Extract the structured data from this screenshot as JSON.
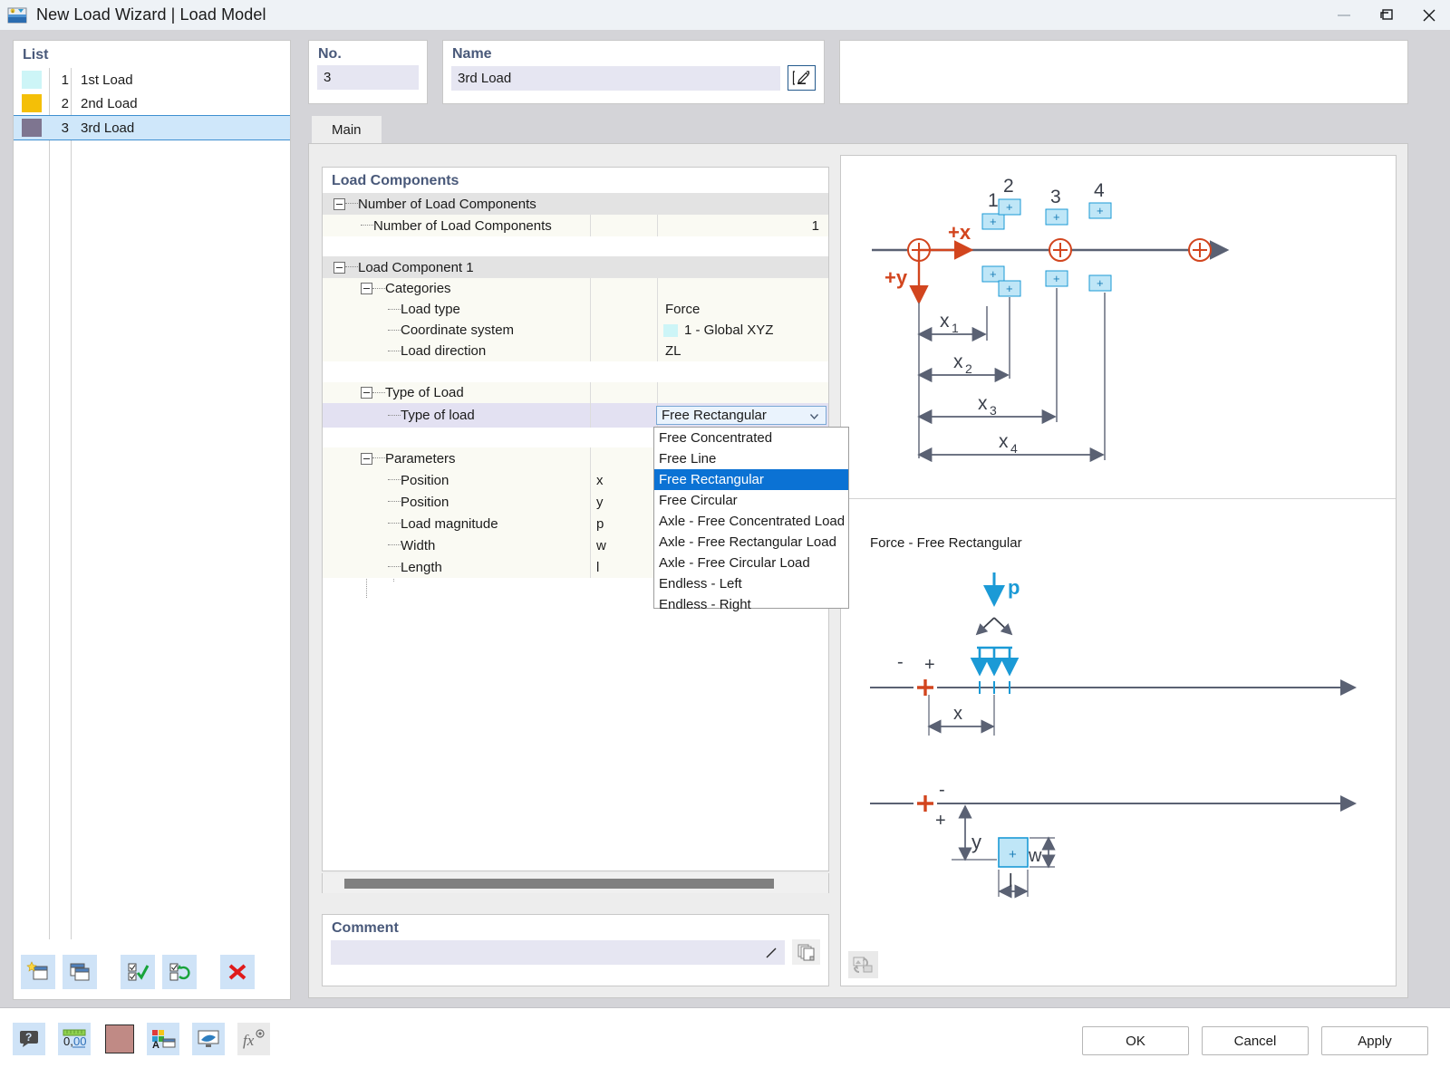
{
  "window": {
    "title": "New Load Wizard | Load Model",
    "app_icon": "load-model-icon",
    "minimize_label": "Minimize",
    "restore_label": "Restore",
    "close_label": "Close"
  },
  "list_panel": {
    "header": "List",
    "items": [
      {
        "num": "1",
        "name": "1st Load",
        "color": "#cdf5f7",
        "selected": false
      },
      {
        "num": "2",
        "name": "2nd Load",
        "color": "#f4bf07",
        "selected": false
      },
      {
        "num": "3",
        "name": "3rd Load",
        "color": "#7e7590",
        "selected": true
      }
    ],
    "tools": [
      {
        "name": "new-load-button",
        "icon": "new-window-icon"
      },
      {
        "name": "copy-load-button",
        "icon": "copy-window-icon"
      },
      {
        "name": "select-all-button",
        "icon": "check-all-icon"
      },
      {
        "name": "invert-selection-button",
        "icon": "invert-selection-icon"
      },
      {
        "name": "delete-load-button",
        "icon": "red-x-icon"
      }
    ]
  },
  "no_box": {
    "label": "No.",
    "value": "3"
  },
  "name_box": {
    "label": "Name",
    "value": "3rd Load",
    "placeholder": "",
    "edit_button": "edit-name-icon"
  },
  "tabs": [
    {
      "label": "Main",
      "active": true
    }
  ],
  "load_components": {
    "header": "Load Components",
    "rows": [
      {
        "kind": "group",
        "indent": 0,
        "label": "Number of Load Components",
        "expander": true
      },
      {
        "kind": "leaf",
        "indent": 1,
        "label": "Number of Load Components",
        "symbol": "",
        "value": "1"
      },
      {
        "kind": "blank",
        "indent": 1,
        "label": "",
        "symbol": "",
        "value": ""
      },
      {
        "kind": "group",
        "indent": 0,
        "label": "Load Component 1",
        "expander": true
      },
      {
        "kind": "group2",
        "indent": 1,
        "label": "Categories",
        "expander": true
      },
      {
        "kind": "leaf",
        "indent": 2,
        "label": "Load type",
        "symbol": "",
        "value": "Force"
      },
      {
        "kind": "leaf",
        "indent": 2,
        "label": "Coordinate system",
        "symbol": "",
        "value": "1 - Global XYZ",
        "swatch": "#cdf5f7"
      },
      {
        "kind": "leaf",
        "indent": 2,
        "label": "Load direction",
        "symbol": "",
        "value": "ZL"
      },
      {
        "kind": "blank",
        "indent": 2,
        "label": "",
        "symbol": "",
        "value": ""
      },
      {
        "kind": "group2",
        "indent": 1,
        "label": "Type of Load",
        "expander": true
      },
      {
        "kind": "selrow",
        "indent": 2,
        "label": "Type of load",
        "symbol": "",
        "value": "Free Rectangular"
      },
      {
        "kind": "blank",
        "indent": 2,
        "label": "",
        "symbol": "",
        "value": ""
      },
      {
        "kind": "group2",
        "indent": 1,
        "label": "Parameters",
        "expander": true
      },
      {
        "kind": "leaf",
        "indent": 2,
        "label": "Position",
        "symbol": "x",
        "value": ""
      },
      {
        "kind": "leaf",
        "indent": 2,
        "label": "Position",
        "symbol": "y",
        "value": ""
      },
      {
        "kind": "leaf",
        "indent": 2,
        "label": "Load magnitude",
        "symbol": "p",
        "value": ""
      },
      {
        "kind": "leaf",
        "indent": 2,
        "label": "Width",
        "symbol": "w",
        "value": ""
      },
      {
        "kind": "leaf",
        "indent": 2,
        "label": "Length",
        "symbol": "l",
        "value": ""
      }
    ]
  },
  "type_of_load_dropdown": {
    "selected": "Free Rectangular",
    "open": true,
    "options": [
      "Free Concentrated",
      "Free Line",
      "Free Rectangular",
      "Free Circular",
      "Axle - Free Concentrated Load",
      "Axle - Free Rectangular Load",
      "Axle - Free Circular Load",
      "Endless - Left",
      "Endless - Right"
    ]
  },
  "comment": {
    "label": "Comment",
    "value": "",
    "placeholder": "",
    "button_icon": "copy-comment-icon"
  },
  "illustration": {
    "caption": "Force - Free Rectangular",
    "refresh_icon": "refresh-image-icon",
    "axle_labels": [
      "1",
      "2",
      "3",
      "4"
    ],
    "axis_labels": [
      "+x",
      "+y"
    ],
    "dimension_labels": [
      "x",
      "x",
      "x",
      "x"
    ],
    "dimension_subs": [
      "1",
      "2",
      "3",
      "4"
    ],
    "detail_labels": [
      "p",
      "x",
      "y",
      "w",
      "l"
    ],
    "sign_labels": [
      "-",
      "+",
      "-",
      "+"
    ],
    "accent_red": "#d2451e",
    "accent_blue": "#1b9ad6",
    "line_gray": "#5a6173"
  },
  "bottom_bar": {
    "tools": [
      {
        "name": "help-button",
        "icon": "help-balloon-icon"
      },
      {
        "name": "decimal-places-button",
        "icon": "decimals-icon"
      },
      {
        "name": "color-button",
        "icon": "color-swatch-icon",
        "color": "#c08a85"
      },
      {
        "name": "display-properties-button",
        "icon": "display-props-icon"
      },
      {
        "name": "visual-settings-button",
        "icon": "render-settings-icon"
      },
      {
        "name": "formula-button",
        "icon": "fx-icon"
      }
    ],
    "buttons": [
      {
        "name": "ok-button",
        "label": "OK"
      },
      {
        "name": "cancel-button",
        "label": "Cancel"
      },
      {
        "name": "apply-button",
        "label": "Apply"
      }
    ]
  }
}
